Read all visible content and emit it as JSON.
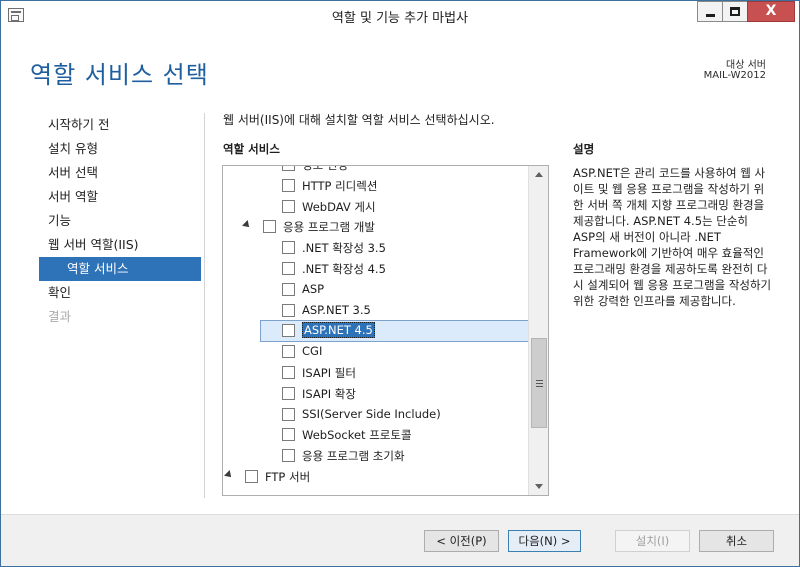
{
  "window": {
    "title": "역할 및 기능 추가 마법사",
    "close_label": "X"
  },
  "header": {
    "page_title": "역할 서비스 선택",
    "target_label": "대상 서버",
    "target_name": "MAIL-W2012"
  },
  "nav": {
    "items": [
      {
        "label": "시작하기 전"
      },
      {
        "label": "설치 유형"
      },
      {
        "label": "서버 선택"
      },
      {
        "label": "서버 역할"
      },
      {
        "label": "기능"
      },
      {
        "label": "웹 서버 역할(IIS)"
      },
      {
        "label": "역할 서비스"
      },
      {
        "label": "확인"
      },
      {
        "label": "결과"
      }
    ]
  },
  "main": {
    "instruction": "웹 서버(IIS)에 대해 설치할 역할 서비스 선택하십시오.",
    "list_heading": "역할 서비스",
    "tree_items": [
      {
        "label": "경로 변경"
      },
      {
        "label": "HTTP 리디렉션"
      },
      {
        "label": "WebDAV 게시"
      },
      {
        "label": "응용 프로그램 개발"
      },
      {
        "label": ".NET 확장성 3.5"
      },
      {
        "label": ".NET 확장성 4.5"
      },
      {
        "label": "ASP"
      },
      {
        "label": "ASP.NET 3.5"
      },
      {
        "label": "ASP.NET 4.5"
      },
      {
        "label": "CGI"
      },
      {
        "label": "ISAPI 필터"
      },
      {
        "label": "ISAPI 확장"
      },
      {
        "label": "SSI(Server Side Include)"
      },
      {
        "label": "WebSocket 프로토콜"
      },
      {
        "label": "응용 프로그램 초기화"
      },
      {
        "label": "FTP 서버"
      }
    ],
    "description_heading": "설명",
    "description_text": "ASP.NET은 관리 코드를 사용하여 웹 사이트 및 웹 응용 프로그램을 작성하기 위한 서버 쪽 개체 지향 프로그래밍 환경을 제공합니다. ASP.NET 4.5는 단순히 ASP의 새 버전이 아니라 .NET Framework에 기반하여 매우 효율적인 프로그래밍 환경을 제공하도록 완전히 다시 설계되어 웹 응용 프로그램을 작성하기 위한 강력한 인프라를 제공합니다."
  },
  "footer": {
    "prev_label": "< 이전(P)",
    "next_label": "다음(N) >",
    "install_label": "설치(I)",
    "cancel_label": "취소"
  },
  "colors": {
    "accent": "#2e72b8",
    "title_blue": "#1f5fa0",
    "selection": "#dcebfc"
  }
}
